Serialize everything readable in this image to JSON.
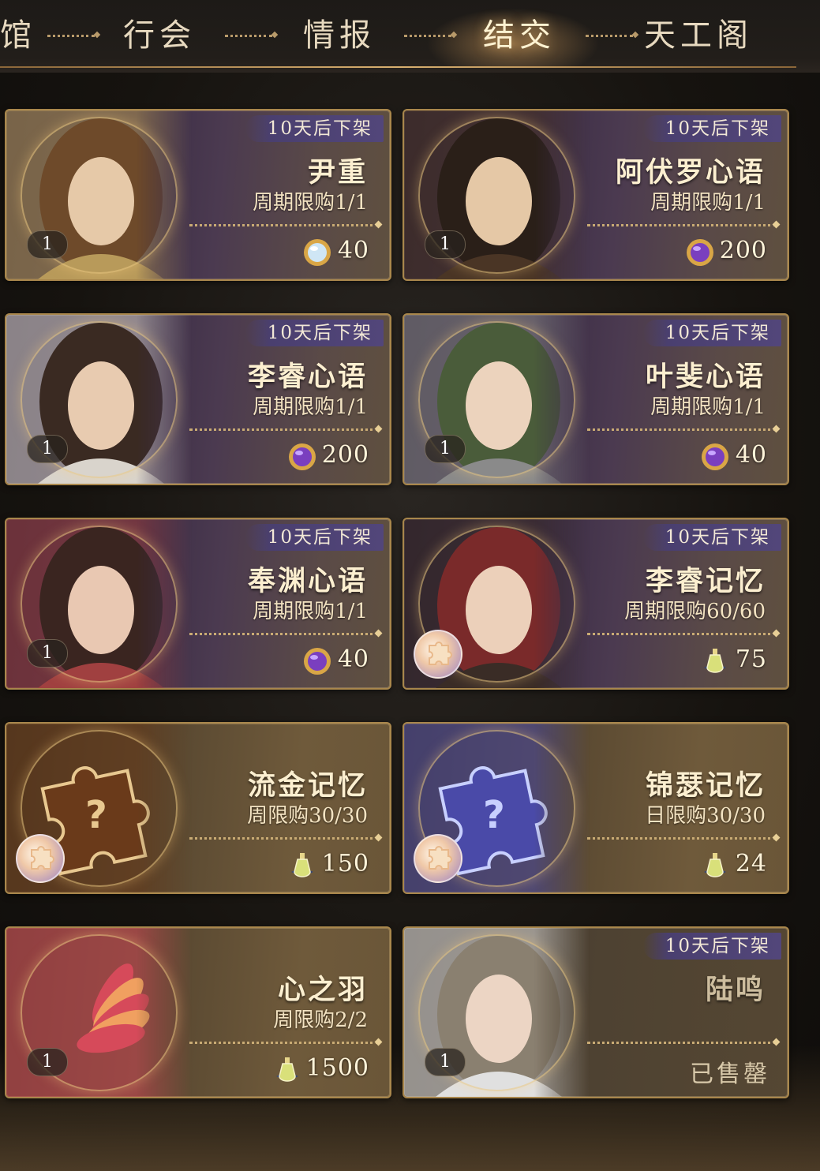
{
  "tabs": [
    {
      "label": "馆",
      "active": false
    },
    {
      "label": "行会",
      "active": false
    },
    {
      "label": "情报",
      "active": false
    },
    {
      "label": "结交",
      "active": true
    },
    {
      "label": "天工阁",
      "active": false
    }
  ],
  "cards": [
    {
      "title": "尹重",
      "limit": "周期限购1/1",
      "timer": "10天后下架",
      "price": "40",
      "currency": "crystal-icon",
      "qty": "1",
      "style": "purple"
    },
    {
      "title": "阿伏罗心语",
      "limit": "周期限购1/1",
      "timer": "10天后下架",
      "price": "200",
      "currency": "purple-gem-icon",
      "qty": "1",
      "style": "purple"
    },
    {
      "title": "李睿心语",
      "limit": "周期限购1/1",
      "timer": "10天后下架",
      "price": "200",
      "currency": "purple-gem-icon",
      "qty": "1",
      "style": "purple"
    },
    {
      "title": "叶斐心语",
      "limit": "周期限购1/1",
      "timer": "10天后下架",
      "price": "40",
      "currency": "purple-gem-icon",
      "qty": "1",
      "style": "purple"
    },
    {
      "title": "奉渊心语",
      "limit": "周期限购1/1",
      "timer": "10天后下架",
      "price": "40",
      "currency": "purple-gem-icon",
      "qty": "1",
      "style": "purple"
    },
    {
      "title": "李睿记忆",
      "limit": "周期限购60/60",
      "timer": "10天后下架",
      "price": "75",
      "currency": "potion-icon",
      "qty": "",
      "style": "purple"
    },
    {
      "title": "流金记忆",
      "limit": "周限购30/30",
      "timer": "",
      "price": "150",
      "currency": "potion-icon",
      "qty": "",
      "style": "gold"
    },
    {
      "title": "锦瑟记忆",
      "limit": "日限购30/30",
      "timer": "",
      "price": "24",
      "currency": "potion-icon",
      "qty": "",
      "style": "gold"
    },
    {
      "title": "心之羽",
      "limit": "周限购2/2",
      "timer": "",
      "price": "1500",
      "currency": "potion-icon",
      "qty": "1",
      "style": "gold"
    },
    {
      "title": "陆鸣",
      "limit": "",
      "timer": "10天后下架",
      "price": "",
      "currency": "",
      "qty": "1",
      "style": "soldout",
      "status": "已售罄"
    }
  ]
}
